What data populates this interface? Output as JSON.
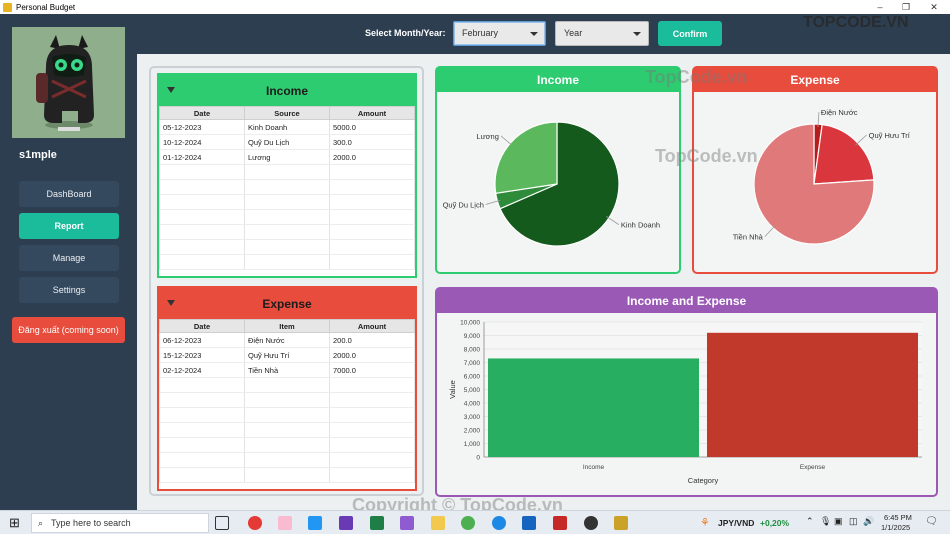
{
  "window": {
    "title": "Personal Budget"
  },
  "sidebar": {
    "username": "s1mple",
    "nav": [
      {
        "label": "DashBoard",
        "active": false
      },
      {
        "label": "Report",
        "active": true
      },
      {
        "label": "Manage",
        "active": false
      },
      {
        "label": "Settings",
        "active": false
      }
    ],
    "logout_label": "Đăng xuất (coming soon)"
  },
  "toolbar": {
    "select_label": "Select Month/Year:",
    "month_value": "February",
    "year_value": "Year",
    "confirm_label": "Confirm"
  },
  "income_table": {
    "title": "Income",
    "columns": [
      "Date",
      "Source",
      "Amount"
    ],
    "rows": [
      [
        "05-12-2023",
        "Kinh Doanh",
        "5000.0"
      ],
      [
        "10-12-2024",
        "Quỹ Du Lịch",
        "300.0"
      ],
      [
        "01-12-2024",
        "Lương",
        "2000.0"
      ]
    ]
  },
  "expense_table": {
    "title": "Expense",
    "columns": [
      "Date",
      "Item",
      "Amount"
    ],
    "rows": [
      [
        "06-12-2023",
        "Điện Nước",
        "200.0"
      ],
      [
        "15-12-2023",
        "Quỹ Hưu Trí",
        "2000.0"
      ],
      [
        "02-12-2024",
        "Tiền Nhà",
        "7000.0"
      ]
    ]
  },
  "colors": {
    "income_green": "#2ecc71",
    "expense_red": "#e74c3c",
    "purple": "#9b59b6",
    "teal": "#1abc9c"
  },
  "chart_data": [
    {
      "type": "pie",
      "title": "Income",
      "labels": [
        "Kinh Doanh",
        "Quỹ Du Lịch",
        "Lương"
      ],
      "values": [
        5000,
        300,
        2000
      ]
    },
    {
      "type": "pie",
      "title": "Expense",
      "labels": [
        "Điện Nước",
        "Quỹ Hưu Trí",
        "Tiền Nhà"
      ],
      "values": [
        200,
        2000,
        7000
      ]
    },
    {
      "type": "bar",
      "title": "Income and Expense",
      "categories": [
        "Income",
        "Expense"
      ],
      "values": [
        7300,
        9200
      ],
      "xlabel": "Category",
      "ylabel": "Value",
      "ylim": [
        0,
        10000
      ],
      "yticks": [
        "0",
        "1,000",
        "2,000",
        "3,000",
        "4,000",
        "5,000",
        "6,000",
        "7,000",
        "8,000",
        "9,000",
        "10,000"
      ]
    }
  ],
  "taskbar": {
    "search_placeholder": "Type here to search",
    "stock_name": "JPY/VND",
    "stock_change": "+0,20%",
    "time": "6:45 PM",
    "date": "1/1/2025"
  },
  "watermarks": [
    "TopCode.vn",
    "TopCode.vn",
    "Copyright © TopCode.vn",
    "TOPCODE.VN"
  ]
}
